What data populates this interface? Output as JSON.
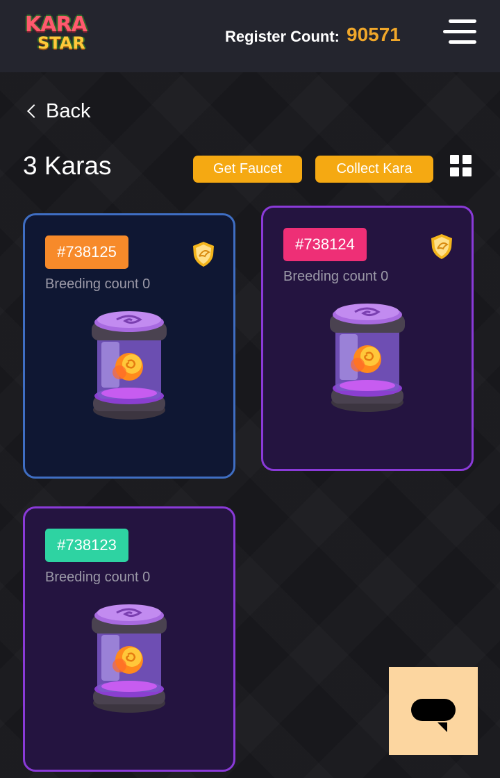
{
  "header": {
    "logo_top": "KARA",
    "logo_bottom": "STAR",
    "register_label": "Register Count:",
    "register_value": "90571",
    "menu_icon": "hamburger-menu-icon"
  },
  "nav": {
    "back_label": "Back"
  },
  "toolbar": {
    "title": "3 Karas",
    "get_faucet_label": "Get Faucet",
    "collect_kara_label": "Collect Kara",
    "grid_icon": "grid-view-icon"
  },
  "cards": [
    {
      "id": "#738125",
      "breeding": "Breeding count 0",
      "tag_color": "#f78a2a",
      "style": "blue",
      "has_shield": true
    },
    {
      "id": "#738124",
      "breeding": "Breeding count 0",
      "tag_color": "#ee2f76",
      "style": "purple",
      "has_shield": true
    },
    {
      "id": "#738123",
      "breeding": "Breeding count 0",
      "tag_color": "#2ed3a2",
      "style": "purple",
      "has_shield": false
    }
  ],
  "colors": {
    "accent_yellow": "#f5a912",
    "register_value": "#f0a72a",
    "card_blue_border": "#3f6ec3",
    "card_purple_border": "#8a3ad8",
    "chat_button_bg": "#fcd6a0"
  },
  "chat": {
    "icon": "chat-bubble-icon"
  }
}
